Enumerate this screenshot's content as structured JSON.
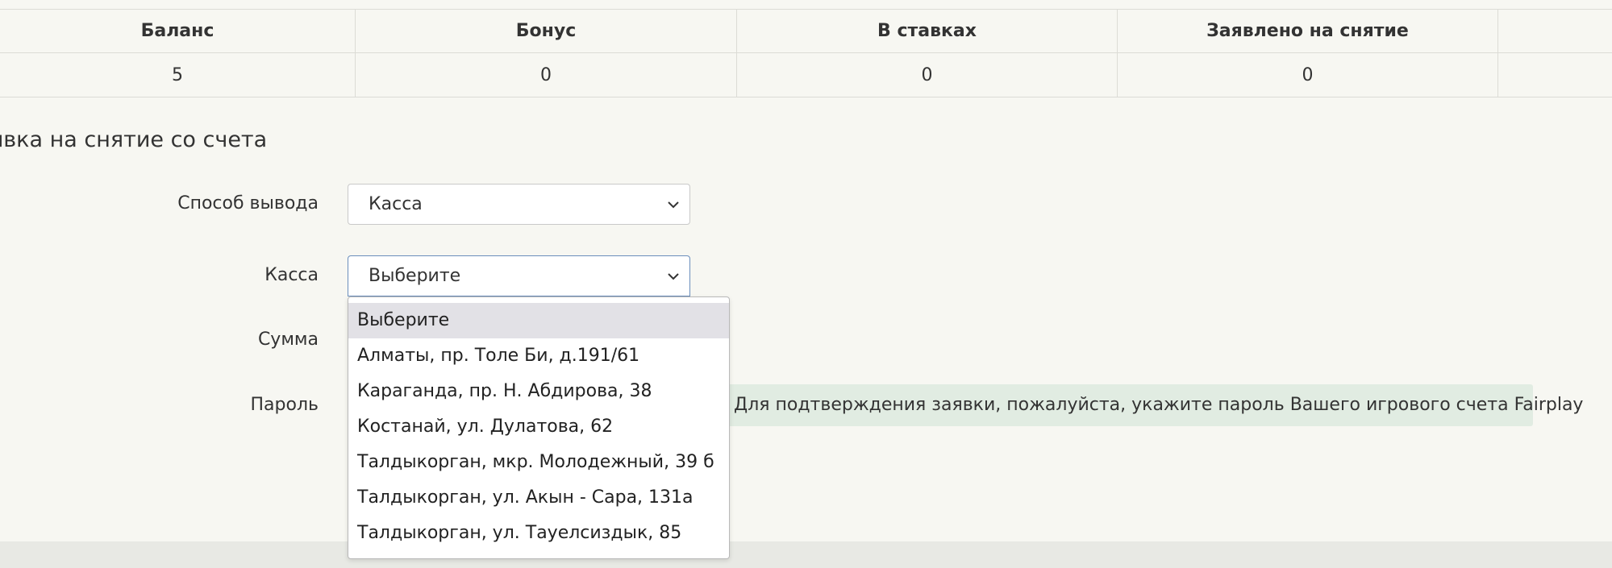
{
  "summary": {
    "headers": [
      "Баланс",
      "Бонус",
      "В ставках",
      "Заявлено на снятие",
      ""
    ],
    "values": [
      "5",
      "0",
      "0",
      "0",
      ""
    ]
  },
  "withdraw": {
    "title": "явка на снятие со счета",
    "method_label": "Способ вывода",
    "method_value": "Касса",
    "cashdesk_label": "Касса",
    "cashdesk_value": "Выберите",
    "amount_label": "Сумма",
    "password_label": "Пароль",
    "password_hint": "Для подтверждения заявки, пожалуйста, укажите пароль Вашего игрового счета Fairplay"
  },
  "cashdesk_options": [
    "Выберите",
    "Алматы, пр. Толе Би, д.191/61",
    "Караганда, пр. Н. Абдирова, 38",
    "Костанай, ул. Дулатова, 62",
    "Талдыкорган, мкр. Молодежный, 39 б",
    "Талдыкорган, ул. Акын - Сара, 131а",
    "Талдыкорган, ул. Тауелсиздык, 85"
  ],
  "icons": {
    "select_arrow": "chevron-down-icon"
  },
  "colors": {
    "background": "#f7f7f2",
    "hint_bg": "#e1ece2",
    "focus_border": "#6a8ebc"
  }
}
